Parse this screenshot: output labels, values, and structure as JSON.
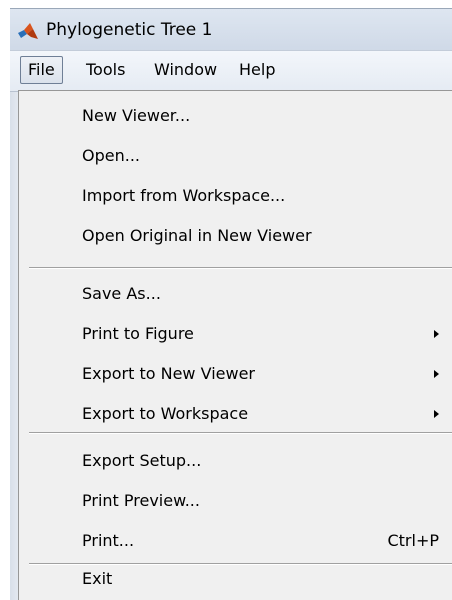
{
  "window": {
    "title": "Phylogenetic Tree 1",
    "app_icon": "matlab-logo-icon"
  },
  "menubar": {
    "items": [
      {
        "label": "File",
        "active": true
      },
      {
        "label": "Tools"
      },
      {
        "label": "Window"
      },
      {
        "label": "Help"
      }
    ]
  },
  "file_menu": {
    "groups": [
      [
        {
          "label": "New Viewer..."
        },
        {
          "label": "Open..."
        },
        {
          "label": "Import from Workspace..."
        },
        {
          "label": "Open Original in New Viewer"
        }
      ],
      [
        {
          "label": "Save As..."
        },
        {
          "label": "Print to Figure",
          "submenu": true,
          "icon": "submenu-arrow-icon"
        },
        {
          "label": "Export to New Viewer",
          "submenu": true,
          "icon": "submenu-arrow-icon"
        },
        {
          "label": "Export to Workspace",
          "submenu": true,
          "icon": "submenu-arrow-icon"
        }
      ],
      [
        {
          "label": "Export Setup..."
        },
        {
          "label": "Print Preview..."
        },
        {
          "label": "Print...",
          "shortcut": "Ctrl+P"
        }
      ],
      [
        {
          "label": "Exit"
        }
      ]
    ]
  }
}
